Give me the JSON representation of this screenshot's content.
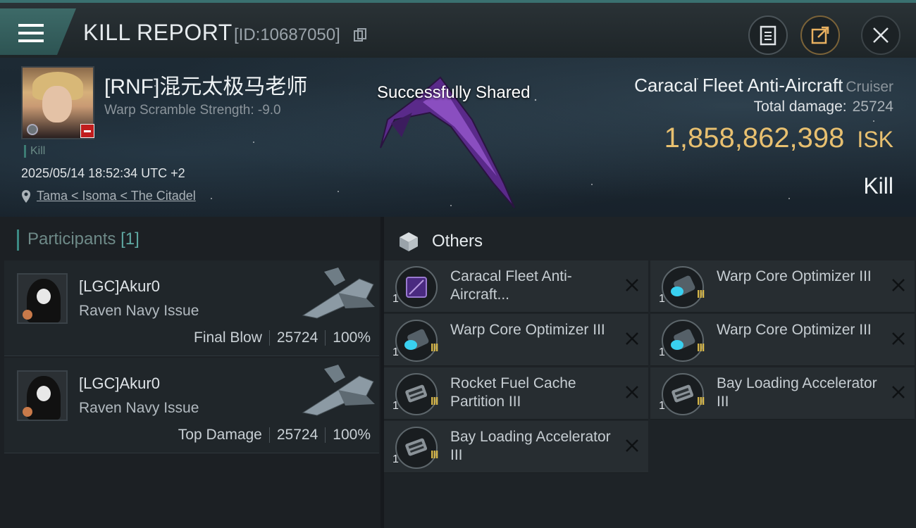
{
  "header": {
    "title": "KILL REPORT",
    "report_id": "[ID:10687050]"
  },
  "victim": {
    "pilot_name": "[RNF]混元太极马老师",
    "warp_scramble": "Warp Scramble Strength: -9.0",
    "kill_tag": "Kill",
    "datetime": "2025/05/14 18:52:34 UTC +2",
    "location": "Tama < Isoma < The Citadel",
    "shared_toast": "Successfully Shared",
    "ship_name": "Caracal Fleet Anti-Aircraft",
    "ship_class": "Cruiser",
    "total_damage_label": "Total damage:",
    "total_damage": "25724",
    "isk_value": "1,858,862,398",
    "isk_unit": "ISK",
    "result": "Kill"
  },
  "participants": {
    "label": "Participants",
    "count": "[1]",
    "cards": [
      {
        "name": "[LGC]Akur0",
        "ship": "Raven Navy Issue",
        "role": "Final Blow",
        "damage": "25724",
        "percent": "100%"
      },
      {
        "name": "[LGC]Akur0",
        "ship": "Raven Navy Issue",
        "role": "Top Damage",
        "damage": "25724",
        "percent": "100%"
      }
    ]
  },
  "others": {
    "label": "Others",
    "items": [
      {
        "name": "Caracal Fleet Anti-Aircraft...",
        "qty": "1",
        "tier": "",
        "icon": "ship-hull-icon"
      },
      {
        "name": "Warp Core Optimizer III",
        "qty": "1",
        "tier": "III",
        "icon": "warp-core-icon"
      },
      {
        "name": "Warp Core Optimizer III",
        "qty": "1",
        "tier": "III",
        "icon": "warp-core-icon"
      },
      {
        "name": "Warp Core Optimizer III",
        "qty": "1",
        "tier": "III",
        "icon": "warp-core-icon"
      },
      {
        "name": "Rocket Fuel Cache Partition III",
        "qty": "1",
        "tier": "III",
        "icon": "rig-module-icon"
      },
      {
        "name": "Bay Loading Accelerator III",
        "qty": "1",
        "tier": "III",
        "icon": "rig-module-icon"
      },
      {
        "name": "Bay Loading Accelerator III",
        "qty": "1",
        "tier": "III",
        "icon": "rig-module-icon"
      }
    ]
  }
}
